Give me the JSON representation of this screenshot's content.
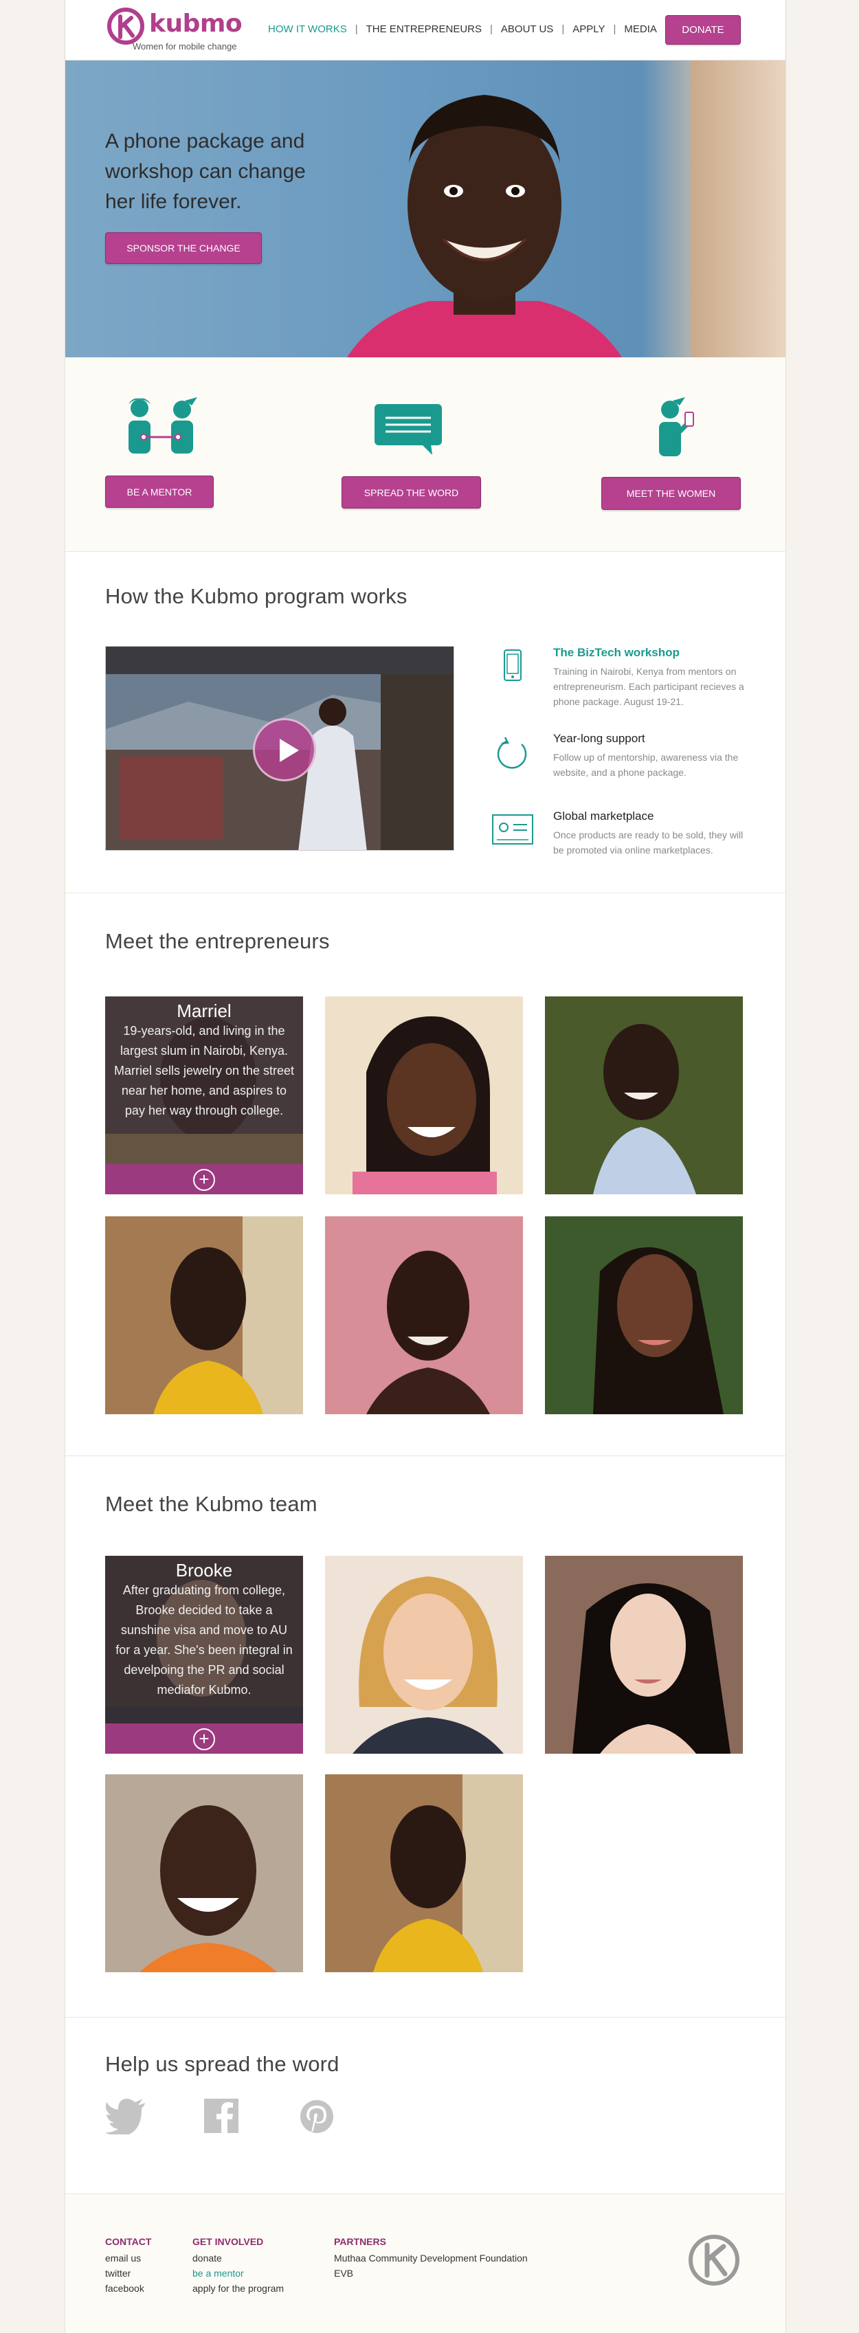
{
  "header": {
    "brand": "kubmo",
    "tagline": "Women for mobile change",
    "nav": [
      {
        "label": "HOW IT WORKS",
        "active": true
      },
      {
        "label": "THE ENTREPRENEURS",
        "active": false
      },
      {
        "label": "ABOUT US",
        "active": false
      },
      {
        "label": "APPLY",
        "active": false
      },
      {
        "label": "MEDIA",
        "active": false
      }
    ],
    "separator": "|",
    "donate_label": "DONATE"
  },
  "hero": {
    "headline": "A phone package and workshop can change her life forever.",
    "cta_label": "SPONSOR THE CHANGE"
  },
  "cta_row": {
    "mentor_label": "BE A MENTOR",
    "spread_label": "SPREAD THE WORD",
    "meet_label": "MEET THE WOMEN"
  },
  "program": {
    "title": "How the Kubmo program works",
    "features": [
      {
        "title": "The BizTech workshop",
        "text": "Training in Nairobi, Kenya from mentors on entrepreneurism. Each participant recieves a phone package. August 19-21.",
        "icon": "phone-icon"
      },
      {
        "title": "Year-long support",
        "text": "Follow up of mentorship, awareness via the website, and a phone package.",
        "icon": "refresh-cycle-icon"
      },
      {
        "title": "Global marketplace",
        "text": "Once products are ready to be sold, they will be promoted via online marketplaces.",
        "icon": "marketplace-screen-icon"
      }
    ]
  },
  "entrepreneurs": {
    "title": "Meet the entrepreneurs",
    "featured": {
      "name": "Marriel",
      "bio": "19-years-old, and living in the largest slum in Nairobi, Kenya.  Marriel sells jewelry on the street near her home, and aspires to pay her way through college."
    },
    "expand_symbol": "+"
  },
  "team": {
    "title": "Meet the Kubmo team",
    "featured": {
      "name": "Brooke",
      "bio": "After graduating from college, Brooke decided to take a sunshine visa and move to AU for a year. She's been integral in develpoing the PR and social mediafor Kubmo."
    },
    "expand_symbol": "+"
  },
  "spread": {
    "title": "Help us spread the word",
    "icons": [
      "twitter-icon",
      "facebook-icon",
      "pinterest-icon"
    ]
  },
  "footer": {
    "contact": {
      "heading": "CONTACT",
      "links": [
        "email us",
        "twitter",
        "facebook"
      ]
    },
    "involved": {
      "heading": "GET INVOLVED",
      "links": [
        "donate",
        "be a mentor",
        "apply for the program"
      ]
    },
    "partners": {
      "heading": "PARTNERS",
      "links": [
        "Muthaa Community Development Foundation",
        "EVB"
      ]
    }
  },
  "colors": {
    "brand": "#b5418f",
    "accent_teal": "#1a9a8f",
    "background": "#f6f3ee"
  }
}
